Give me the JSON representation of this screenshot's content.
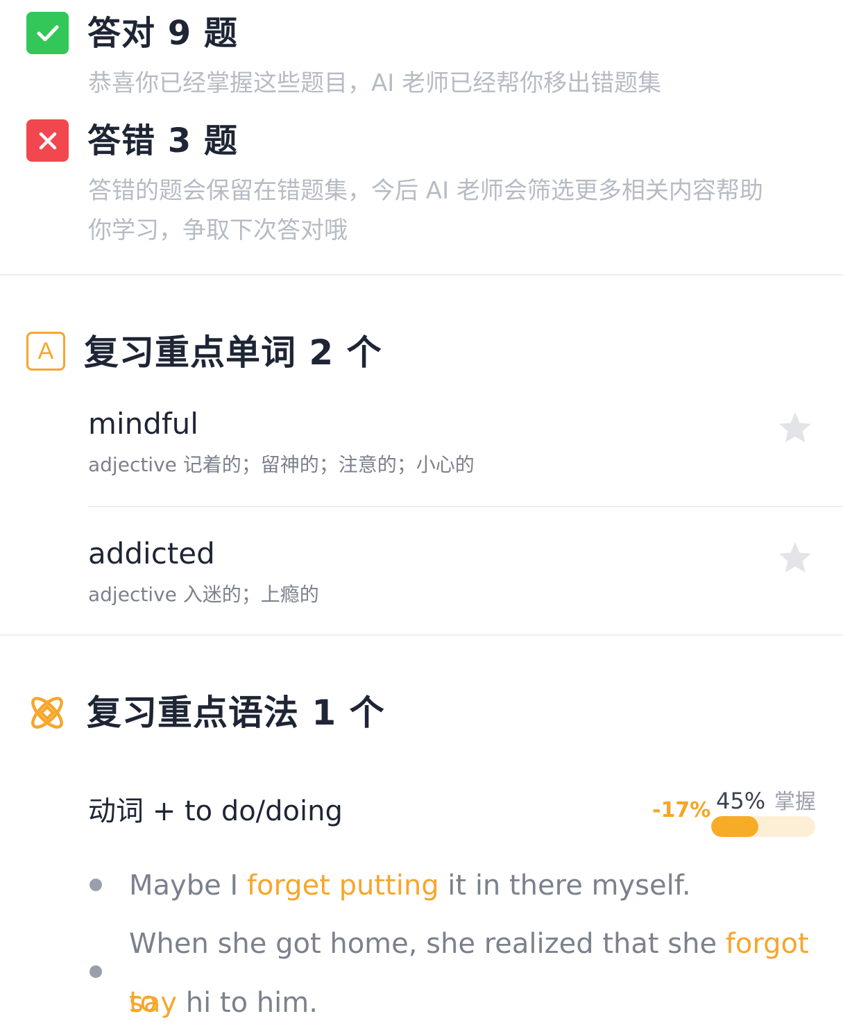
{
  "results": {
    "correct": {
      "title": "答对 9 题",
      "desc": "恭喜你已经掌握这些题目，AI 老师已经帮你移出错题集",
      "icon": "check-icon",
      "color": "#33c75a"
    },
    "wrong": {
      "title": "答错 3 题",
      "desc_line1": "答错的题会保留在错题集，今后 AI 老师会筛选更多相关内容帮助",
      "desc_line2": "你学习，争取下次答对哦",
      "icon": "close-icon",
      "color": "#f2474f"
    }
  },
  "words_section": {
    "title": "复习重点单词 2 个",
    "icon_letter": "A",
    "icon": "letter-a-icon",
    "accent": "#f7a62b",
    "items": [
      {
        "word": "mindful",
        "definition": "adjective 记着的；留神的；注意的；小心的",
        "icon": "star-icon"
      },
      {
        "word": "addicted",
        "definition": "adjective 入迷的；上瘾的",
        "icon": "star-icon"
      }
    ]
  },
  "grammar_section": {
    "title": "复习重点语法 1 个",
    "icon": "atom-icon",
    "item": {
      "title": "动词 + to do/doing",
      "trend": "-17%",
      "mastery_percent_label": "45%",
      "mastery_fraction": 0.45,
      "mastery_label": "掌握"
    },
    "examples": [
      {
        "line1_pre": "Maybe I ",
        "line1_hl": "forget putting",
        "line1_post": " it in there myself."
      },
      {
        "line1_pre": "When she got home, she realized that she ",
        "line1_hl": "forgot to",
        "line2_hl": "say",
        "line2_post": " hi to him."
      }
    ]
  }
}
